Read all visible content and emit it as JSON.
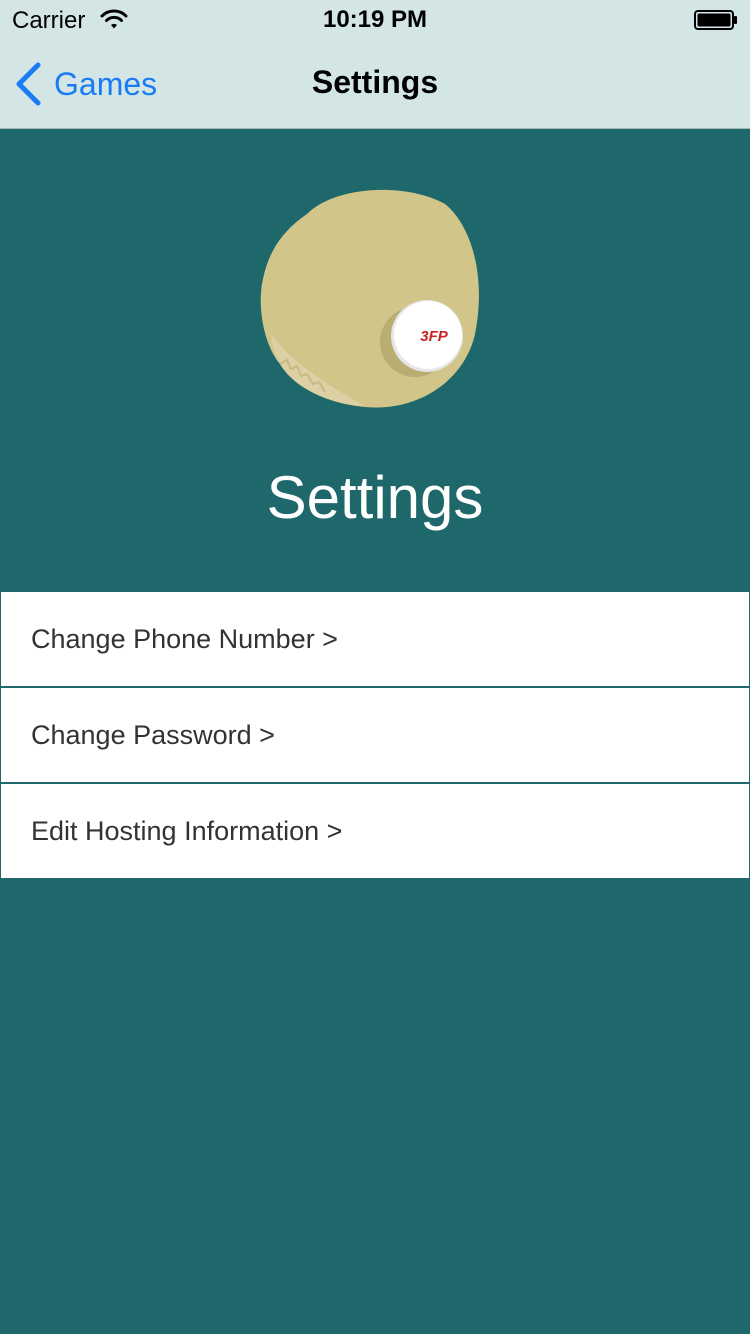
{
  "status_bar": {
    "carrier": "Carrier",
    "time": "10:19 PM",
    "wifi_icon": "wifi-icon",
    "battery_icon": "battery-icon"
  },
  "nav": {
    "back_label": "Games",
    "back_icon": "chevron-left-icon",
    "title": "Settings"
  },
  "hero": {
    "logo_text": "3FP",
    "title": "Settings"
  },
  "menu": {
    "items": [
      {
        "label": "Change Phone Number >"
      },
      {
        "label": "Change Password >"
      },
      {
        "label": "Edit Hosting Information >"
      }
    ]
  },
  "colors": {
    "bar_background": "#d3e6e5",
    "page_background": "#1e686b",
    "accent": "#1a7cf5",
    "logo_paddle": "#d2c58a",
    "logo_text": "#cc2222"
  }
}
